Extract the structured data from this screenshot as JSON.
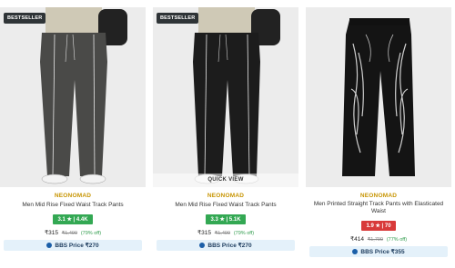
{
  "products": [
    {
      "badge": "BESTSELLER",
      "brand": "NEONOMAD",
      "title": "Men Mid Rise Fixed Waist Track Pants",
      "rating": "3.1 ★ | 4.4K",
      "rating_color": "#33a853",
      "price": "₹315",
      "mrp": "₹1,499",
      "discount": "(79% off)",
      "bbs_label": "BBS Price ₹270",
      "quick_view": ""
    },
    {
      "badge": "BESTSELLER",
      "brand": "NEONOMAD",
      "title": "Men Mid Rise Fixed Waist Track Pants",
      "rating": "3.3 ★ | 5.1K",
      "rating_color": "#33a853",
      "price": "₹315",
      "mrp": "₹1,499",
      "discount": "(79% off)",
      "bbs_label": "BBS Price ₹270",
      "quick_view": "QUICK VIEW"
    },
    {
      "badge": "",
      "brand": "NEONOMAD",
      "title": "Men Printed Straight Track Pants with Elasticated Waist",
      "rating": "1.9 ★ | 70",
      "rating_color": "#d83a3a",
      "price": "₹414",
      "mrp": "₹1,799",
      "discount": "(77% off)",
      "bbs_label": "BBS Price ₹355",
      "quick_view": ""
    }
  ],
  "icons": {
    "wishlist": "heart-icon",
    "bbs": "bbs-coin-icon"
  },
  "colors": {
    "brand": "#c79400",
    "bbs_bg": "#e4f1fa",
    "badge_bg": "#2f3437"
  }
}
